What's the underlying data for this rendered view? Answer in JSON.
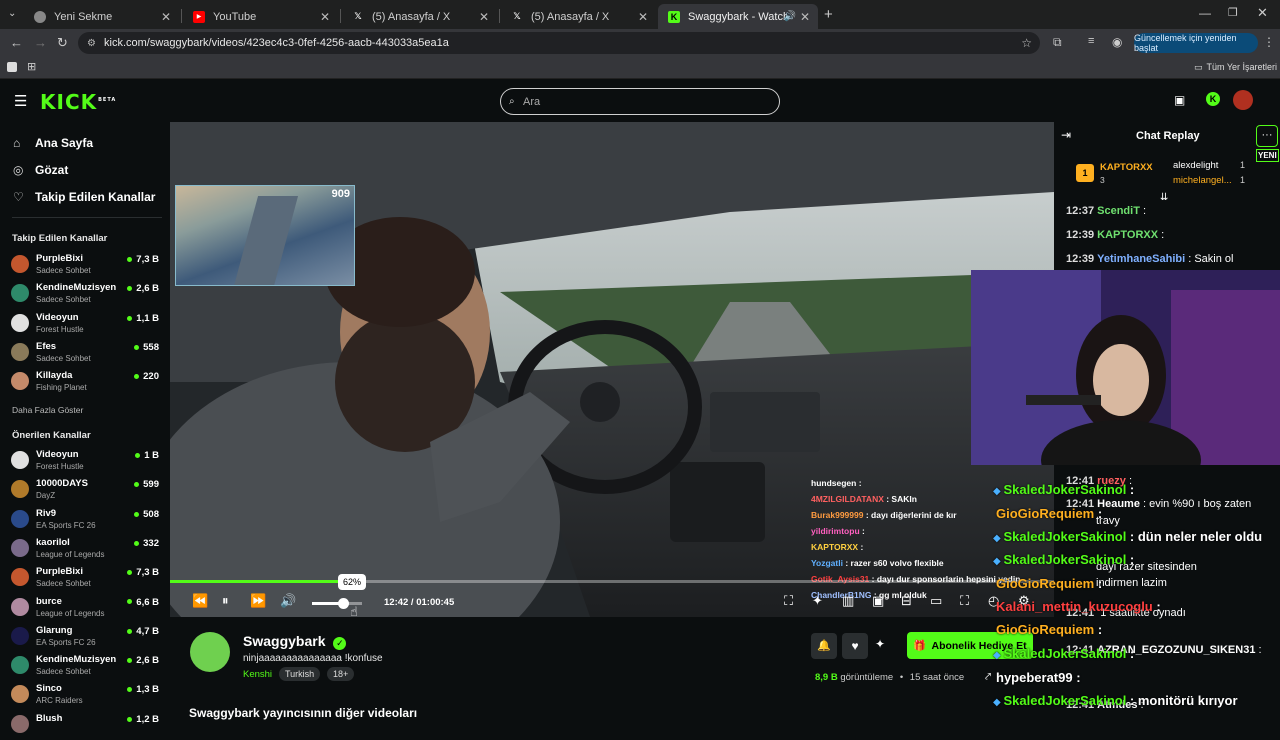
{
  "browser": {
    "tabs": [
      {
        "label": "Yeni Sekme",
        "icon": "chrome-icon"
      },
      {
        "label": "YouTube",
        "icon": "youtube-icon"
      },
      {
        "label": "(5) Anasayfa / X",
        "icon": "x-icon"
      },
      {
        "label": "(5) Anasayfa / X",
        "icon": "x-icon"
      },
      {
        "label": "Swaggybark - Watch the VO",
        "icon": "kick-icon"
      }
    ],
    "url": "kick.com/swaggybark/videos/423ec4c3-0fef-4256-aacb-443033a5ea1a",
    "update_button": "Güncellemek için yeniden başlat",
    "bookmarks_label": "Tüm Yer İşaretleri"
  },
  "header": {
    "logo": "KICK",
    "logo_badge": "BETA",
    "search_placeholder": "Ara"
  },
  "sidebar": {
    "nav": [
      {
        "label": "Ana Sayfa",
        "icon": "home-icon"
      },
      {
        "label": "Gözat",
        "icon": "compass-icon"
      },
      {
        "label": "Takip Edilen Kanallar",
        "icon": "heart-icon"
      }
    ],
    "followed_title": "Takip Edilen Kanallar",
    "followed": [
      {
        "name": "PurpleBixi",
        "category": "Sadece Sohbet",
        "viewers": "7,3 B",
        "color": "#c4572e"
      },
      {
        "name": "KendineMuzisyen",
        "category": "Sadece Sohbet",
        "viewers": "2,6 B",
        "color": "#2e8a6a"
      },
      {
        "name": "Videoyun",
        "category": "Forest Hustle",
        "viewers": "1,1 B",
        "color": "#e0e0e0"
      },
      {
        "name": "Efes",
        "category": "Sadece Sohbet",
        "viewers": "558",
        "color": "#8a7a5a"
      },
      {
        "name": "Killayda",
        "category": "Fishing Planet",
        "viewers": "220",
        "color": "#c48a6a"
      }
    ],
    "show_more": "Daha Fazla Göster",
    "recommended_title": "Önerilen Kanallar",
    "recommended": [
      {
        "name": "Videoyun",
        "category": "Forest Hustle",
        "viewers": "1 B",
        "color": "#e0e0e0"
      },
      {
        "name": "10000DAYS",
        "category": "DayZ",
        "viewers": "599",
        "color": "#b07a2a"
      },
      {
        "name": "Riv9",
        "category": "EA Sports FC 26",
        "viewers": "508",
        "color": "#2a4a8a"
      },
      {
        "name": "kaorilol",
        "category": "League of Legends",
        "viewers": "332",
        "color": "#7a6a8a"
      },
      {
        "name": "PurpleBixi",
        "category": "Sadece Sohbet",
        "viewers": "7,3 B",
        "color": "#c4572e"
      },
      {
        "name": "burce",
        "category": "League of Legends",
        "viewers": "6,6 B",
        "color": "#b08aa0"
      },
      {
        "name": "Glarung",
        "category": "EA Sports FC 26",
        "viewers": "4,7 B",
        "color": "#1a1a4a"
      },
      {
        "name": "KendineMuzisyen",
        "category": "Sadece Sohbet",
        "viewers": "2,6 B",
        "color": "#2e8a6a"
      },
      {
        "name": "Sinco",
        "category": "ARC Raiders",
        "viewers": "1,3 B",
        "color": "#c48a5a"
      },
      {
        "name": "Blush",
        "category": "",
        "viewers": "1,2 B",
        "color": "#8a6a6a"
      }
    ]
  },
  "player": {
    "pip_counter": "909",
    "progress": 0.2112,
    "volume_tooltip": "62%",
    "volume": 0.62,
    "time": "12:42 / 01:00:45"
  },
  "video_overlay_chat": [
    {
      "user": "hundsegen",
      "text": ":",
      "color": "#ffffff"
    },
    {
      "user": "4MZILGILDATANX",
      "text": ": SAKIn",
      "color": "#ff6060"
    },
    {
      "user": "Burak999999",
      "text": ": dayı diğerlerini de kır",
      "color": "#ff9b40"
    },
    {
      "user": "yildirimtopu",
      "text": ":",
      "color": "#ff60c0"
    },
    {
      "user": "KAPTORXX",
      "text": ":",
      "color": "#ffd040"
    },
    {
      "user": "Yozgatli",
      "text": ": razer s60 volvo flexible",
      "color": "#60b0ff"
    },
    {
      "user": "Gotik_Aysis31",
      "text": ": dayı dur sponsorlarin hepsini yedin",
      "color": "#ff4040"
    },
    {
      "user": "ChandlerB1NG",
      "text": ": gg ml olduk",
      "color": "#a0c0ff"
    }
  ],
  "channel": {
    "name": "Swaggybark",
    "title": "ninjaaaaaaaaaaaaaaa !konfuse",
    "category": "Kenshi",
    "tags": [
      "Turkish",
      "18+"
    ],
    "views": "8,9 B",
    "views_label": "görüntüleme",
    "ago": "15 saat önce",
    "subscribe_gift": "Abonelik Hediye Et",
    "other_videos": "Swaggybark yayıncısının diğer videoları"
  },
  "chat": {
    "title": "Chat Replay",
    "new_badge": "YENI",
    "top_gifters": [
      {
        "name": "KAPTORXX",
        "count": "3",
        "rank": "1"
      },
      {
        "name": "alexdelight",
        "count": "1"
      },
      {
        "name": "michelangel...",
        "count": "1"
      }
    ],
    "messages": [
      {
        "time": "12:37",
        "user": "ScendiT",
        "text": ":",
        "color": "#6fe06f"
      },
      {
        "time": "12:39",
        "user": "KAPTORXX",
        "text": ":",
        "color": "#6fe06f"
      },
      {
        "time": "12:39",
        "user": "YetimhaneSahibi",
        "text": ": Sakin ol",
        "color": "#7fb0ff"
      }
    ],
    "lower_messages": [
      {
        "time": "12:41",
        "user": "ruezy",
        "text": ":",
        "color": "#ff6060"
      },
      {
        "time": "12:41",
        "user": "Heaume",
        "text": ": evin %90 ı boş zaten",
        "color": "#ffffff"
      },
      {
        "time": "",
        "user": "",
        "text": "travy",
        "color": "#ffffff"
      },
      {
        "time": "",
        "user": "",
        "text": "dayi razer sitesinden",
        "color": "#ffffff"
      },
      {
        "time": "",
        "user": "",
        "text": "indirmen lazim",
        "color": "#ffffff"
      },
      {
        "time": "12:41",
        "user": "",
        "text": "1 saatlikte oynadı",
        "color": "#ffffff"
      },
      {
        "time": "12:41",
        "user": "AZRAN_EGZOZUNU_SIKEN31",
        "text": ":",
        "color": "#ffffff"
      },
      {
        "time": "12:41",
        "user": "Atmdes",
        "text": ":",
        "color": "#ffffff"
      }
    ],
    "big_overlay": [
      {
        "user": "SkaledJokerSakinol",
        "text": ":",
        "color": "#53fc18"
      },
      {
        "user": "GioGioRequiem",
        "text": ":",
        "color": "#ffb020"
      },
      {
        "user": "SkaledJokerSakinol",
        "text": ": dün neler neler oldu",
        "color": "#53fc18"
      },
      {
        "user": "SkaledJokerSakinol",
        "text": ":",
        "color": "#53fc18"
      },
      {
        "user": "GioGioRequiem",
        "text": ":",
        "color": "#ffb020"
      },
      {
        "user": "Kalani_mettin_kuzucoglu",
        "text": ":",
        "color": "#ff4040"
      },
      {
        "user": "GioGioRequiem",
        "text": ":",
        "color": "#ffb020"
      },
      {
        "user": "SkaledJokerSakinol",
        "text": ":",
        "color": "#53fc18"
      },
      {
        "user": "hypeberat99",
        "text": ":",
        "color": "#ffffff"
      },
      {
        "user": "SkaledJokerSakinol",
        "text": ": monitörü kırıyor",
        "color": "#53fc18"
      },
      {
        "user": "GioGioRequiem",
        "text": ":",
        "color": "#ffb020"
      }
    ]
  },
  "colors": {
    "accent": "#53fc18",
    "bg": "#0b0e0f"
  }
}
